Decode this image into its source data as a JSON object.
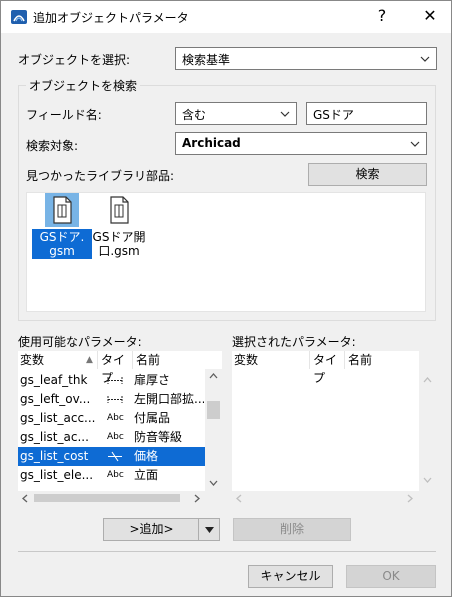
{
  "window": {
    "title": "追加オブジェクトパラメータ",
    "help": "?",
    "close": "✕"
  },
  "select_object": {
    "label": "オブジェクトを選択:",
    "value": "検索基準"
  },
  "search_group": {
    "title": "オブジェクトを検索",
    "field_label": "フィールド名:",
    "condition": "含む",
    "field_value": "GSドア",
    "target_label": "検索対象:",
    "target_value": "Archicad",
    "found_label": "見つかったライブラリ部品:",
    "search_button": "検索",
    "results": [
      {
        "line1": "GSドア.",
        "line2": "gsm",
        "selected": true
      },
      {
        "line1": "GSドア開",
        "line2": "口.gsm",
        "selected": false
      }
    ]
  },
  "available": {
    "title": "使用可能なパラメータ:",
    "columns": [
      "変数",
      "タイプ",
      "名前"
    ],
    "rows": [
      {
        "var": "gs_leaf_thk",
        "type_icon": "length-icon",
        "type_text": "",
        "name": "扉厚さ"
      },
      {
        "var": "gs_left_ov...",
        "type_icon": "length-icon",
        "type_text": "",
        "name": "左開口部拡..."
      },
      {
        "var": "gs_list_acc...",
        "type_icon": "abc-icon",
        "type_text": "Abc",
        "name": "付属品"
      },
      {
        "var": "gs_list_ac...",
        "type_icon": "abc-icon",
        "type_text": "Abc",
        "name": "防音等級"
      },
      {
        "var": "gs_list_cost",
        "type_icon": "real-number-icon",
        "type_text": "",
        "name": "価格"
      },
      {
        "var": "gs_list_ele...",
        "type_icon": "abc-icon",
        "type_text": "Abc",
        "name": "立面"
      }
    ],
    "selected_index": 4
  },
  "selected_params": {
    "title": "選択されたパラメータ:",
    "columns": [
      "変数",
      "タイプ",
      "名前"
    ]
  },
  "buttons": {
    "add": ">追加>",
    "remove": "削除",
    "cancel": "キャンセル",
    "ok": "OK"
  }
}
